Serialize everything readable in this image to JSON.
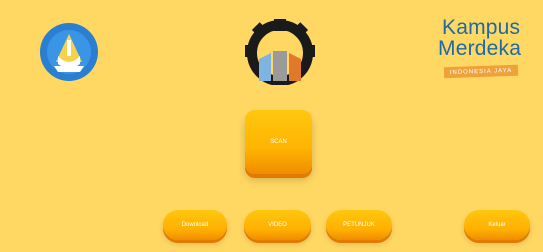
{
  "logos": {
    "left": "tut-wuri-handayani-emblem",
    "center": "gear-emblem",
    "right": {
      "line1": "Kampus",
      "line2": "Merdeka",
      "tagline": "INDONESIA JAYA"
    }
  },
  "buttons": {
    "scan": "SCAN",
    "download": "Download",
    "video": "VIDEO",
    "petunjuk": "PETUNJUK",
    "keluar": "Keluar"
  },
  "colors": {
    "background": "#ffd763",
    "button": "#ffb400",
    "brand_blue": "#1e6aa6"
  }
}
